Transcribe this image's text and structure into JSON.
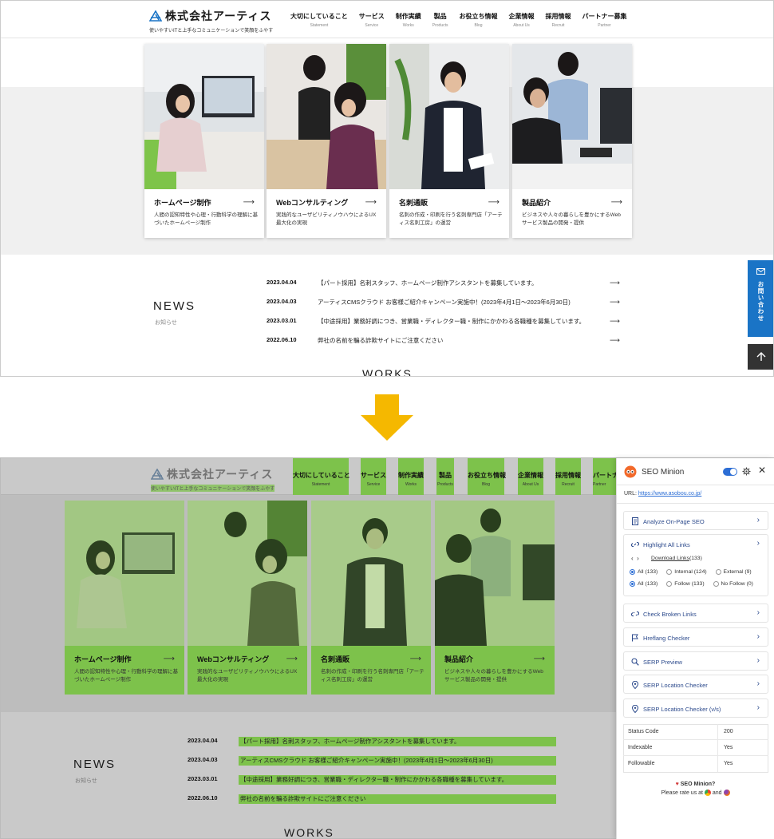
{
  "logo": {
    "title": "株式会社アーティス",
    "subtitle": "使いやすいITと上手なコミュニケーションで笑顔をふやす"
  },
  "nav": [
    {
      "label": "大切にしていること",
      "sub": "Statement"
    },
    {
      "label": "サービス",
      "sub": "Service"
    },
    {
      "label": "制作実績",
      "sub": "Works"
    },
    {
      "label": "製品",
      "sub": "Products"
    },
    {
      "label": "お役立ち情報",
      "sub": "Blog"
    },
    {
      "label": "企業情報",
      "sub": "About Us"
    },
    {
      "label": "採用情報",
      "sub": "Recruit"
    },
    {
      "label": "パートナー募集",
      "sub": "Partner"
    }
  ],
  "cards": [
    {
      "title": "ホームページ制作",
      "desc": "人間の認知特性や心理・行動科学の理解に基づいたホームページ制作"
    },
    {
      "title": "Webコンサルティング",
      "desc": "実践的なユーザビリティノウハウによるUX最大化の実現"
    },
    {
      "title": "名刺通販",
      "desc": "名刺の作成・印刷を行う名刺専門店「アーティス名刺工房」の運営"
    },
    {
      "title": "製品紹介",
      "desc": "ビジネスや人々の暮らしを豊かにするWebサービス製品の開発・提供"
    }
  ],
  "news": {
    "title": "NEWS",
    "subtitle": "お知らせ",
    "items": [
      {
        "date": "2023.04.04",
        "text": "【パート採用】名刺スタッフ、ホームページ制作アシスタントを募集しています。"
      },
      {
        "date": "2023.04.03",
        "text": "アーティスCMSクラウド お客様ご紹介キャンペーン実施中！(2023年4月1日〜2023年6月30日)"
      },
      {
        "date": "2023.03.01",
        "text": "【中途採用】業務好調につき、営業職・ディレクター職・制作にかかわる各職種を募集しています。"
      },
      {
        "date": "2022.06.10",
        "text": "弊社の名前を騙る詐欺サイトにご注意ください"
      }
    ]
  },
  "works_title": "WORKS",
  "contact_label": "お問い合わせ",
  "seo": {
    "title": "SEO Minion",
    "url_label": "URL:",
    "url": "https://www.asobou.co.jp/",
    "analyze": "Analyze On-Page SEO",
    "highlight": "Highlight All Links",
    "download": "Download Links",
    "download_count": "(133)",
    "filter1": [
      {
        "label": "All (133)",
        "on": true
      },
      {
        "label": "Internal (124)",
        "on": false
      },
      {
        "label": "External (9)",
        "on": false
      }
    ],
    "filter2": [
      {
        "label": "All (133)",
        "on": true
      },
      {
        "label": "Follow (133)",
        "on": false
      },
      {
        "label": "No Follow (0)",
        "on": false
      }
    ],
    "broken": "Check Broken Links",
    "hreflang": "Hreflang Checker",
    "serp_preview": "SERP Preview",
    "serp_loc": "SERP Location Checker",
    "serp_loc_vs": "SERP Location Checker (v/s)",
    "table": [
      {
        "k": "Status Code",
        "v": "200"
      },
      {
        "k": "Indexable",
        "v": "Yes"
      },
      {
        "k": "Followable",
        "v": "Yes"
      }
    ],
    "love": "SEO Minion?",
    "rate": "Please rate us at",
    "and": "and"
  },
  "colors": {
    "highlight": "#7dc24b",
    "brand_blue": "#1a74c6",
    "panel_link": "#2c4a8c",
    "arrow": "#f5b800"
  }
}
